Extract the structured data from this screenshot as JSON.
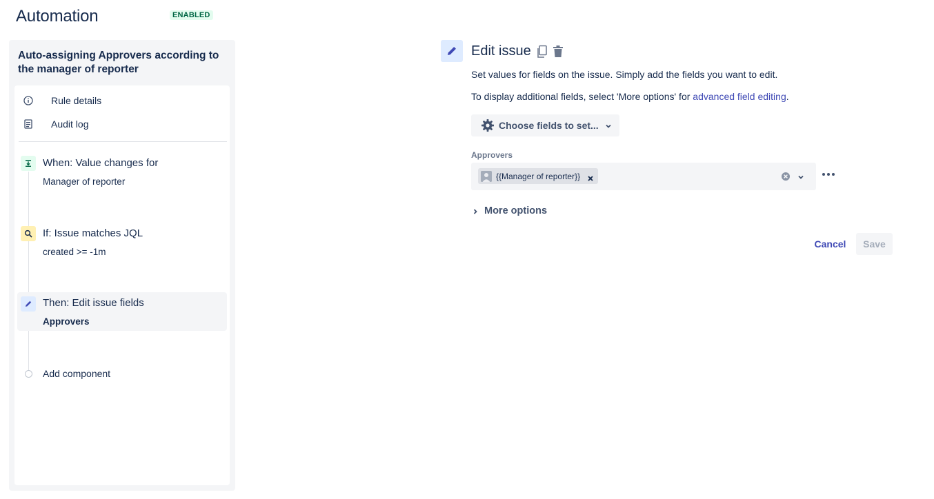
{
  "header": {
    "title": "Automation",
    "status": "ENABLED"
  },
  "rule": {
    "name": "Auto-assigning Approvers according to the manager of reporter",
    "nav": [
      {
        "label": "Rule details",
        "icon": "info-icon"
      },
      {
        "label": "Audit log",
        "icon": "document-icon"
      }
    ],
    "components": [
      {
        "title": "When: Value changes for",
        "subtitle": "Manager of reporter",
        "icon": "trigger-icon"
      },
      {
        "title": "If: Issue matches JQL",
        "subtitle": "created >= -1m",
        "icon": "search-icon"
      },
      {
        "title": "Then: Edit issue fields",
        "subtitle": "Approvers",
        "icon": "pencil-icon"
      }
    ],
    "add_component_label": "Add component"
  },
  "editor": {
    "title": "Edit issue",
    "description": "Set values for fields on the issue. Simply add the fields you want to edit.",
    "hint_prefix": "To display additional fields, select 'More options' for ",
    "hint_link": "advanced field editing",
    "hint_suffix": ".",
    "choose_fields_label": "Choose fields to set...",
    "field": {
      "label": "Approvers",
      "tag": "{{Manager of reporter}}"
    },
    "more_options_label": "More options",
    "cancel_label": "Cancel",
    "save_label": "Save"
  },
  "colors": {
    "accent": "#3f49b5",
    "enabled_bg": "#e3fcef",
    "enabled_text": "#006644",
    "trigger_bg": "#e3fcef",
    "condition_bg": "#fff0b3",
    "action_bg": "#deebff"
  }
}
